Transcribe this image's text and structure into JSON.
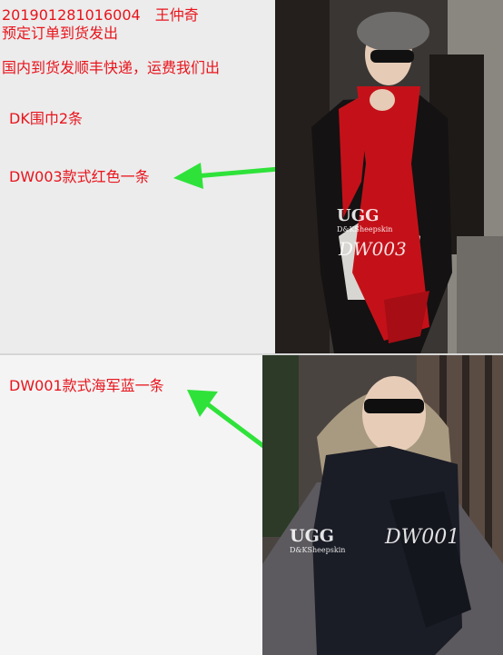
{
  "order": {
    "line1": "201901281016004　王仲奇",
    "line2": "预定订单到货发出",
    "shipping": "国内到货发顺丰快递，运费我们出",
    "summary": "DK围巾2条"
  },
  "items": [
    {
      "label": "DW003款式红色一条",
      "watermark_brand": "UGG",
      "watermark_sub": "D&KSheepskin",
      "watermark_code": "DW003",
      "scarf_color": "#c41119"
    },
    {
      "label": "DW001款式海军蓝一条",
      "watermark_brand": "UGG",
      "watermark_sub": "D&KSheepskin",
      "watermark_code": "DW001",
      "scarf_color": "#1a1c26"
    }
  ],
  "colors": {
    "text": "#e8141c",
    "arrow": "#2fe23a"
  }
}
